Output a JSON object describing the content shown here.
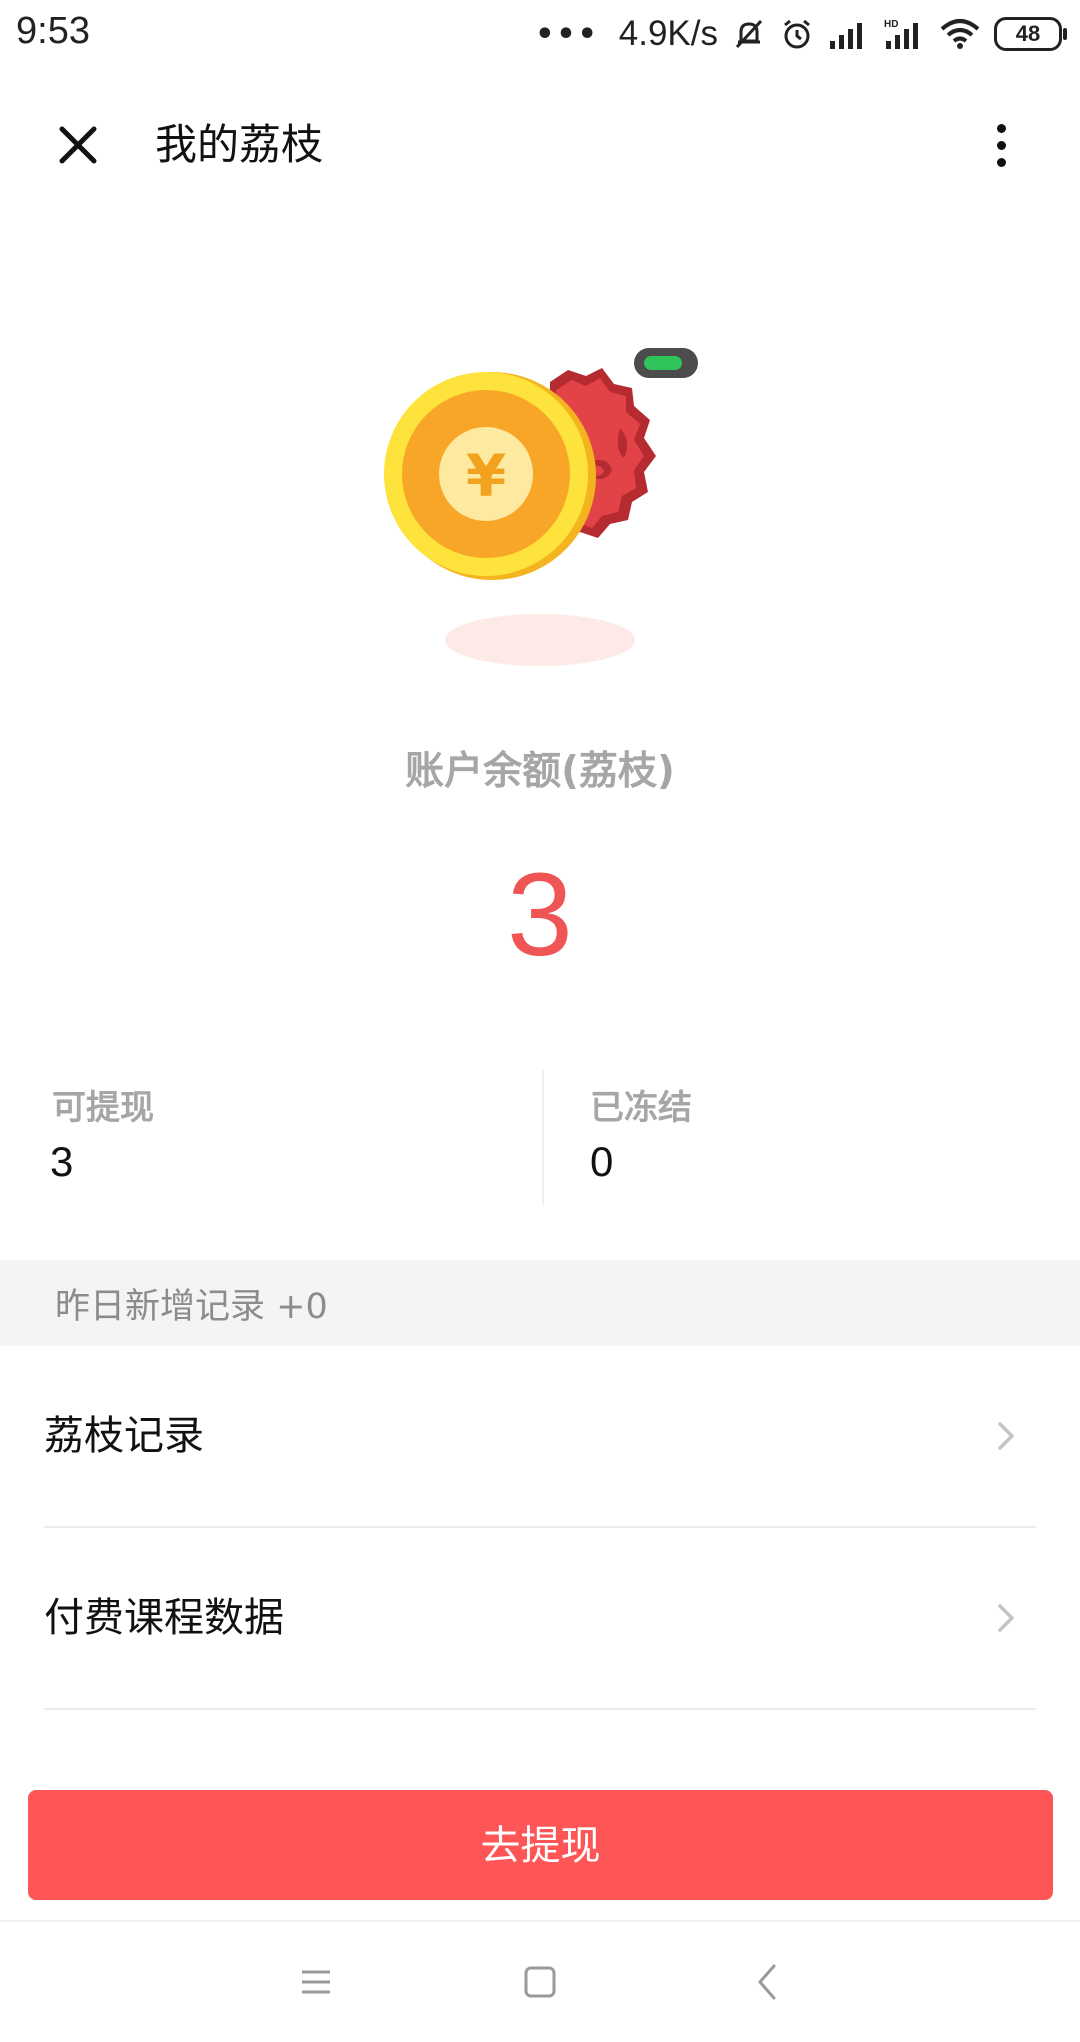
{
  "status_bar": {
    "time": "9:53",
    "dots": "•••",
    "network_speed": "4.9K/s",
    "battery": "48"
  },
  "header": {
    "title": "我的荔枝",
    "close_icon": "close-icon",
    "more_icon": "more-vertical-icon"
  },
  "account": {
    "balance_label": "账户余额(荔枝)",
    "balance": "3",
    "balance_color": "#f05555"
  },
  "stats": {
    "withdrawable_label": "可提现",
    "withdrawable_value": "3",
    "frozen_label": "已冻结",
    "frozen_value": "0"
  },
  "info_strip": {
    "text": "昨日新增记录 +0"
  },
  "list": [
    {
      "label": "荔枝记录",
      "icon": "chevron-right-icon"
    },
    {
      "label": "付费课程数据",
      "icon": "chevron-right-icon"
    }
  ],
  "cta": {
    "label": "去提现",
    "color": "#fe5656"
  },
  "coin_symbol": "¥",
  "nav": {
    "icons": [
      "menu-icon",
      "home-icon",
      "back-icon"
    ]
  }
}
